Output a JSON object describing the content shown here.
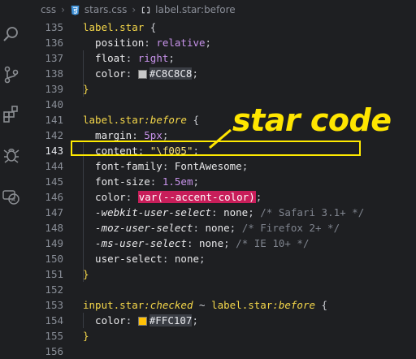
{
  "breadcrumbs": {
    "folder": "css",
    "file": "stars.css",
    "symbol": "label.star:before"
  },
  "annotation": {
    "text": "star code"
  },
  "colors": {
    "swatch_gray": "#C8C8C8",
    "swatch_amber": "#FFC107"
  },
  "lines": [
    {
      "no": "135",
      "tokens": [
        {
          "c": "tok-sel",
          "t": "label.star"
        },
        {
          "c": "tok-punc",
          "t": " {"
        }
      ]
    },
    {
      "no": "136",
      "tokens": [
        {
          "c": "tok-prop",
          "t": "  position"
        },
        {
          "c": "tok-punc",
          "t": ": "
        },
        {
          "c": "tok-val",
          "t": "relative"
        },
        {
          "c": "tok-punc",
          "t": ";"
        }
      ]
    },
    {
      "no": "137",
      "tokens": [
        {
          "c": "tok-prop",
          "t": "  float"
        },
        {
          "c": "tok-punc",
          "t": ": "
        },
        {
          "c": "tok-val",
          "t": "right"
        },
        {
          "c": "tok-punc",
          "t": ";"
        }
      ]
    },
    {
      "no": "138",
      "tokens": [
        {
          "c": "tok-prop",
          "t": "  color"
        },
        {
          "c": "tok-punc",
          "t": ": "
        },
        {
          "c": "swatch",
          "color": "#C8C8C8"
        },
        {
          "c": "tok-hex",
          "t": "#C8C8C8"
        },
        {
          "c": "tok-punc",
          "t": ";"
        }
      ]
    },
    {
      "no": "139",
      "tokens": [
        {
          "c": "tok-sel",
          "t": "}"
        }
      ]
    },
    {
      "no": "140",
      "tokens": []
    },
    {
      "no": "141",
      "tokens": [
        {
          "c": "tok-sel",
          "t": "label.star"
        },
        {
          "c": "tok-sel tok-ital",
          "t": ":before"
        },
        {
          "c": "tok-punc",
          "t": " {"
        }
      ]
    },
    {
      "no": "142",
      "tokens": [
        {
          "c": "tok-prop",
          "t": "  margin"
        },
        {
          "c": "tok-punc",
          "t": ": "
        },
        {
          "c": "tok-val",
          "t": "5px"
        },
        {
          "c": "tok-punc",
          "t": ";"
        }
      ]
    },
    {
      "no": "143",
      "active": true,
      "tokens": [
        {
          "c": "tok-prop",
          "t": "  content"
        },
        {
          "c": "tok-punc",
          "t": ": "
        },
        {
          "c": "tok-str",
          "t": "\"\\f005\""
        },
        {
          "c": "tok-punc",
          "t": ";"
        }
      ]
    },
    {
      "no": "144",
      "tokens": [
        {
          "c": "tok-prop",
          "t": "  font-family"
        },
        {
          "c": "tok-punc",
          "t": ": "
        },
        {
          "c": "tok-prop",
          "t": "FontAwesome"
        },
        {
          "c": "tok-punc",
          "t": ";"
        }
      ]
    },
    {
      "no": "145",
      "tokens": [
        {
          "c": "tok-prop",
          "t": "  font-size"
        },
        {
          "c": "tok-punc",
          "t": ": "
        },
        {
          "c": "tok-val",
          "t": "1.5em"
        },
        {
          "c": "tok-punc",
          "t": ";"
        }
      ]
    },
    {
      "no": "146",
      "tokens": [
        {
          "c": "tok-prop",
          "t": "  color"
        },
        {
          "c": "tok-punc",
          "t": ": "
        },
        {
          "c": "tok-func",
          "t": "var(--accent-color)"
        },
        {
          "c": "tok-punc",
          "t": ";"
        }
      ]
    },
    {
      "no": "147",
      "tokens": [
        {
          "c": "tok-prop tok-ital",
          "t": "  -webkit-user-select"
        },
        {
          "c": "tok-punc",
          "t": ": "
        },
        {
          "c": "tok-prop",
          "t": "none"
        },
        {
          "c": "tok-punc",
          "t": "; "
        },
        {
          "c": "tok-cmt",
          "t": "/* Safari 3.1+ */"
        }
      ]
    },
    {
      "no": "148",
      "tokens": [
        {
          "c": "tok-prop tok-ital",
          "t": "  -moz-user-select"
        },
        {
          "c": "tok-punc",
          "t": ": "
        },
        {
          "c": "tok-prop",
          "t": "none"
        },
        {
          "c": "tok-punc",
          "t": "; "
        },
        {
          "c": "tok-cmt",
          "t": "/* Firefox 2+ */"
        }
      ]
    },
    {
      "no": "149",
      "tokens": [
        {
          "c": "tok-prop tok-ital",
          "t": "  -ms-user-select"
        },
        {
          "c": "tok-punc",
          "t": ": "
        },
        {
          "c": "tok-prop",
          "t": "none"
        },
        {
          "c": "tok-punc",
          "t": "; "
        },
        {
          "c": "tok-cmt",
          "t": "/* IE 10+ */"
        }
      ]
    },
    {
      "no": "150",
      "tokens": [
        {
          "c": "tok-prop",
          "t": "  user-select"
        },
        {
          "c": "tok-punc",
          "t": ": "
        },
        {
          "c": "tok-prop",
          "t": "none"
        },
        {
          "c": "tok-punc",
          "t": ";"
        }
      ]
    },
    {
      "no": "151",
      "tokens": [
        {
          "c": "tok-sel",
          "t": "}"
        }
      ]
    },
    {
      "no": "152",
      "tokens": []
    },
    {
      "no": "153",
      "tokens": [
        {
          "c": "tok-sel",
          "t": "input.star"
        },
        {
          "c": "tok-sel tok-ital",
          "t": ":checked"
        },
        {
          "c": "tok-punc",
          "t": " ~ "
        },
        {
          "c": "tok-sel",
          "t": "label.star"
        },
        {
          "c": "tok-sel tok-ital",
          "t": ":before"
        },
        {
          "c": "tok-punc",
          "t": " {"
        }
      ]
    },
    {
      "no": "154",
      "tokens": [
        {
          "c": "tok-prop",
          "t": "  color"
        },
        {
          "c": "tok-punc",
          "t": ": "
        },
        {
          "c": "swatch",
          "color": "#FFC107"
        },
        {
          "c": "tok-hex",
          "t": "#FFC107"
        },
        {
          "c": "tok-punc",
          "t": ";"
        }
      ]
    },
    {
      "no": "155",
      "tokens": [
        {
          "c": "tok-sel",
          "t": "}"
        }
      ]
    },
    {
      "no": "156",
      "tokens": []
    }
  ],
  "activity_icons": [
    "search-icon",
    "source-control-icon",
    "extensions-icon",
    "debug-icon",
    "remote-icon"
  ]
}
